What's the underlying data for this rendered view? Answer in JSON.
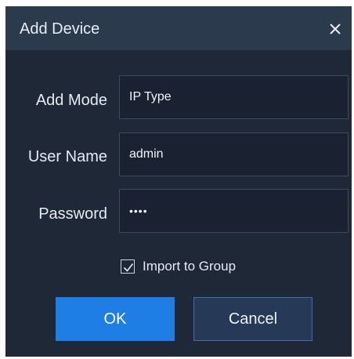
{
  "dialog": {
    "title": "Add Device",
    "close_icon": "close-icon"
  },
  "form": {
    "add_mode": {
      "label": "Add Mode",
      "value": "IP Type"
    },
    "user_name": {
      "label": "User Name",
      "value": "admin"
    },
    "password": {
      "label": "Password",
      "value": "••••"
    }
  },
  "import_to_group": {
    "label": "Import to Group",
    "checked": true
  },
  "buttons": {
    "ok": "OK",
    "cancel": "Cancel"
  },
  "colors": {
    "dialog_bg": "#1e2837",
    "titlebar_bg": "#2c3a4e",
    "field_bg": "#1a2232",
    "primary": "#1f7de6",
    "secondary_btn": "#263a57"
  }
}
